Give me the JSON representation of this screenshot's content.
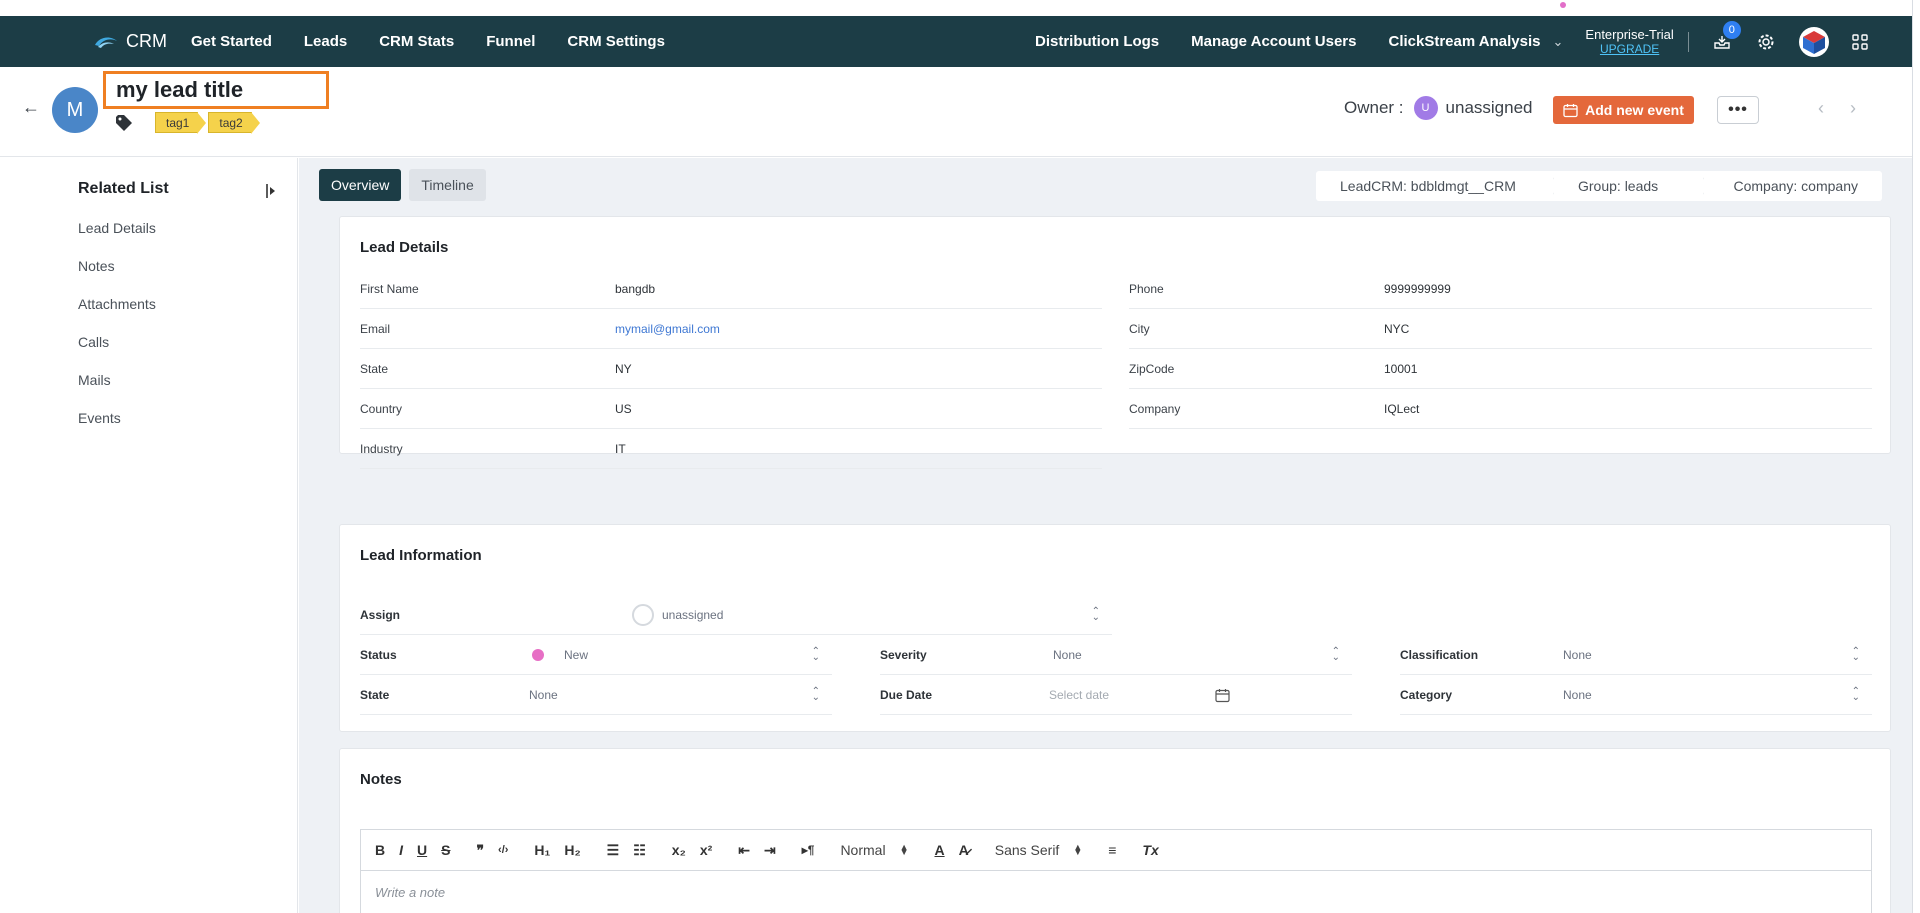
{
  "nav": {
    "brand": "CRM",
    "left_items": [
      "Get Started",
      "Leads",
      "CRM Stats",
      "Funnel",
      "CRM Settings"
    ],
    "right_items": [
      "Distribution Logs",
      "Manage Account Users",
      "ClickStream Analysis"
    ],
    "plan_name": "Enterprise-Trial",
    "plan_link": "UPGRADE",
    "notification_count": "0"
  },
  "header": {
    "avatar_letter": "M",
    "title": "my lead title",
    "tags": [
      "tag1",
      "tag2"
    ],
    "owner_label": "Owner :",
    "owner_initial": "U",
    "owner_name": "unassigned",
    "add_event_label": "Add new event",
    "more_label": "•••"
  },
  "sidebar": {
    "title": "Related List",
    "items": [
      "Lead Details",
      "Notes",
      "Attachments",
      "Calls",
      "Mails",
      "Events"
    ]
  },
  "tabs": [
    "Overview",
    "Timeline"
  ],
  "breadcrumbs": [
    "LeadCRM: bdbldmgt__CRM",
    "Group: leads",
    "Company: company"
  ],
  "lead_details": {
    "title": "Lead Details",
    "left": [
      {
        "label": "First Name",
        "value": "bangdb"
      },
      {
        "label": "Email",
        "value": "mymail@gmail.com"
      },
      {
        "label": "State",
        "value": "NY"
      },
      {
        "label": "Country",
        "value": "US"
      },
      {
        "label": "Industry",
        "value": "IT"
      }
    ],
    "right": [
      {
        "label": "Phone",
        "value": "9999999999"
      },
      {
        "label": "City",
        "value": "NYC"
      },
      {
        "label": "ZipCode",
        "value": "10001"
      },
      {
        "label": "Company",
        "value": "IQLect"
      }
    ]
  },
  "lead_information": {
    "title": "Lead Information",
    "assign_label": "Assign",
    "assign_value": "unassigned",
    "status_label": "Status",
    "status_value": "New",
    "status_color": "#e76fc5",
    "severity_label": "Severity",
    "severity_value": "None",
    "classification_label": "Classification",
    "classification_value": "None",
    "state_label": "State",
    "state_value": "None",
    "due_date_label": "Due Date",
    "due_date_placeholder": "Select date",
    "category_label": "Category",
    "category_value": "None"
  },
  "notes": {
    "title": "Notes",
    "toolbar": {
      "bold": "B",
      "italic": "I",
      "underline": "U",
      "strike": "S",
      "quote": "❞",
      "code": "‹/›",
      "h1": "H₁",
      "h2": "H₂",
      "ordered": "☰",
      "bullet": "☷",
      "sub": "x₂",
      "sup": "x²",
      "outdent": "⇤",
      "indent": "⇥",
      "rtl": "▸¶",
      "size_value": "Normal",
      "color": "A",
      "background": "A̷",
      "font_value": "Sans Serif",
      "align": "≡",
      "clean": "Tx"
    },
    "placeholder": "Write a note"
  },
  "colors": {
    "nav_bg": "#1c3d46",
    "accent": "#e4683b",
    "title_highlight": "#ef7f22",
    "tag_bg": "#f5d24b",
    "link": "#3f78d3"
  }
}
